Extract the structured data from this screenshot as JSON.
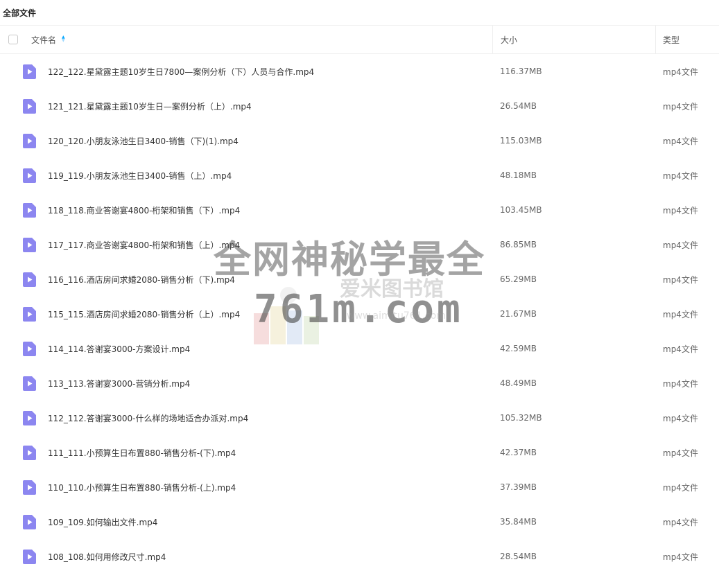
{
  "topbar": {
    "title": "全部文件"
  },
  "header": {
    "name": "文件名",
    "size": "大小",
    "type": "类型"
  },
  "colors": {
    "accent": "#06a7ff",
    "file_icon": "#8c86f0"
  },
  "icons": {
    "file": "video-file-icon",
    "sort": "sort-icon",
    "checkbox": "checkbox-icon"
  },
  "files": [
    {
      "name": "122_122.星黛露主题10岁生日7800—案例分析（下）人员与合作.mp4",
      "size": "116.37MB",
      "type": "mp4文件"
    },
    {
      "name": "121_121.星黛露主题10岁生日—案例分析（上）.mp4",
      "size": "26.54MB",
      "type": "mp4文件"
    },
    {
      "name": "120_120.小朋友泳池生日3400-销售（下)(1).mp4",
      "size": "115.03MB",
      "type": "mp4文件"
    },
    {
      "name": "119_119.小朋友泳池生日3400-销售（上）.mp4",
      "size": "48.18MB",
      "type": "mp4文件"
    },
    {
      "name": "118_118.商业答谢宴4800-桁架和销售（下）.mp4",
      "size": "103.45MB",
      "type": "mp4文件"
    },
    {
      "name": "117_117.商业答谢宴4800-桁架和销售（上）.mp4",
      "size": "86.85MB",
      "type": "mp4文件"
    },
    {
      "name": "116_116.酒店房间求婚2080-销售分析（下).mp4",
      "size": "65.29MB",
      "type": "mp4文件"
    },
    {
      "name": "115_115.酒店房间求婚2080-销售分析（上）.mp4",
      "size": "21.67MB",
      "type": "mp4文件"
    },
    {
      "name": "114_114.答谢宴3000-方案设计.mp4",
      "size": "42.59MB",
      "type": "mp4文件"
    },
    {
      "name": "113_113.答谢宴3000-营销分析.mp4",
      "size": "48.49MB",
      "type": "mp4文件"
    },
    {
      "name": "112_112.答谢宴3000-什么样的场地适合办派对.mp4",
      "size": "105.32MB",
      "type": "mp4文件"
    },
    {
      "name": "111_111.小预算生日布置880-销售分析-(下).mp4",
      "size": "42.37MB",
      "type": "mp4文件"
    },
    {
      "name": "110_110.小预算生日布置880-销售分析-(上).mp4",
      "size": "37.39MB",
      "type": "mp4文件"
    },
    {
      "name": "109_109.如何输出文件.mp4",
      "size": "35.84MB",
      "type": "mp4文件"
    },
    {
      "name": "108_108.如何用修改尺寸.mp4",
      "size": "28.54MB",
      "type": "mp4文件"
    }
  ],
  "watermark": {
    "line1": "全网神秘学最全",
    "line2": "爱米图书馆",
    "line3": "761m.com",
    "line4": "www.aimitu761.com"
  }
}
